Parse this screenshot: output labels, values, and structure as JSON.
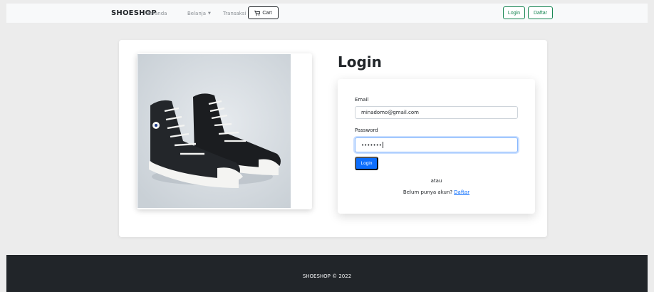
{
  "navbar": {
    "brand": "SHOESHOP",
    "links": {
      "home": "Beranda",
      "shop": "Belanja",
      "transactions": "Transaksi"
    },
    "cart_label": "Cart",
    "login_label": "Login",
    "register_label": "Daftar"
  },
  "login": {
    "title": "Login",
    "email_label": "Email",
    "email_value": "minadomo@gmail.com",
    "password_label": "Password",
    "password_value": "•••••••",
    "submit_label": "Login",
    "or_text": "atau",
    "no_account_text": "Belum punya akun?",
    "register_link": "Daftar"
  },
  "footer": {
    "text": "SHOESHOP © 2022"
  },
  "colors": {
    "primary": "#0d6efd",
    "success": "#198754",
    "dark": "#212529",
    "navbar_bg": "#f8f9fa"
  },
  "icons": {
    "cart": "cart-icon",
    "dropdown": "caret-down-icon"
  }
}
